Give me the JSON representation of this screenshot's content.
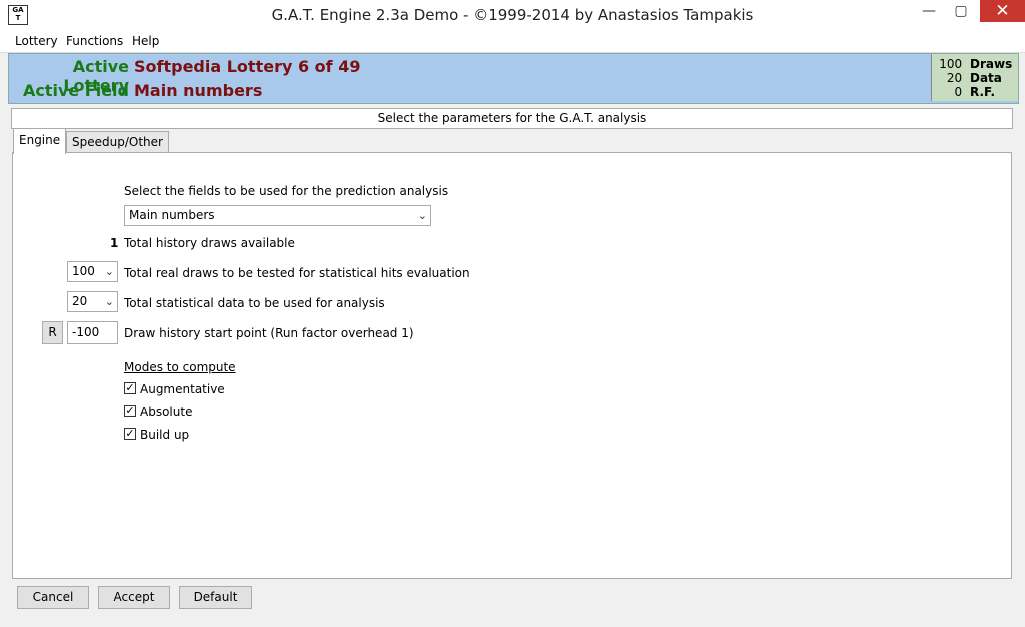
{
  "window": {
    "icon_text": "GA T",
    "title": "G.A.T. Engine 2.3a Demo  - ©1999-2014 by Anastasios Tampakis",
    "min": "—",
    "max": "▢",
    "close": "✕"
  },
  "menu": [
    "Lottery",
    "Functions",
    "Help"
  ],
  "header": {
    "lottery_label": "Active Lottery",
    "lottery_value": "Softpedia Lottery 6 of 49",
    "field_label": "Active Field",
    "field_value": "Main numbers",
    "stats": [
      {
        "value": "100",
        "label": "Draws"
      },
      {
        "value": "20",
        "label": "Data"
      },
      {
        "value": "0",
        "label": "R.F."
      }
    ]
  },
  "info": "Select the parameters for the G.A.T. analysis",
  "tabs": [
    "Engine",
    "Speedup/Other"
  ],
  "engine": {
    "fields_prompt": "Select the fields to be used for the prediction analysis",
    "fields_selected": "Main numbers",
    "history_count": "1",
    "history_label": "Total history draws available",
    "real_draws_value": "100",
    "real_draws_label": "Total real draws to be tested for statistical hits evaluation",
    "stat_data_value": "20",
    "stat_data_label": "Total statistical data to be used for analysis",
    "reset_label": "R",
    "start_value": "-100",
    "start_label": "Draw history start point (Run factor overhead 1)",
    "modes_title": "Modes to compute",
    "modes": [
      {
        "label": "Augmentative",
        "checked": true
      },
      {
        "label": "Absolute",
        "checked": true
      },
      {
        "label": "Build up",
        "checked": true
      }
    ]
  },
  "buttons": {
    "cancel": "Cancel",
    "accept": "Accept",
    "default": "Default"
  },
  "icons": {
    "chevron": "chevron-down-icon",
    "check": "checkmark-icon"
  },
  "colors": {
    "header_bg": "#a8c9ec",
    "label_green": "#1a7a1a",
    "value_red": "#7a1010",
    "stats_bg": "#c8dcc0",
    "close_red": "#c7372f"
  }
}
